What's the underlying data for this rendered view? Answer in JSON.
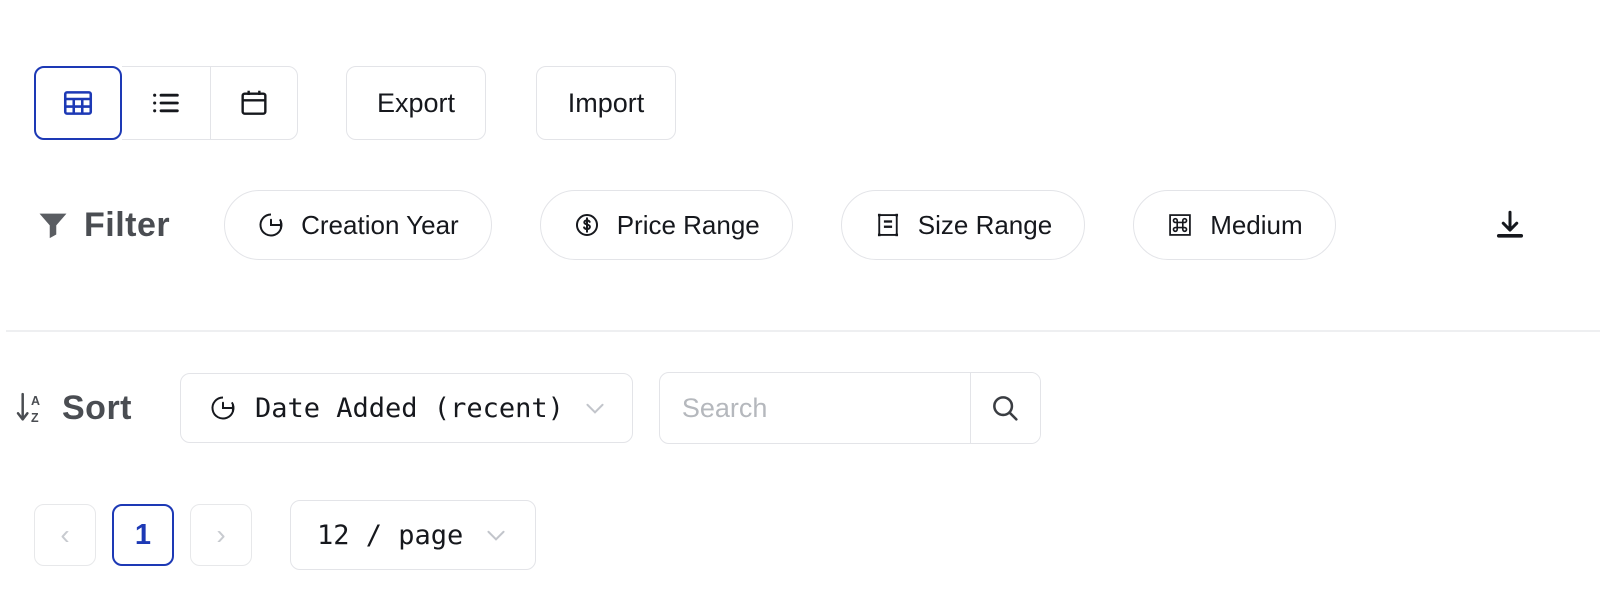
{
  "toolbar": {
    "views": [
      {
        "name": "grid",
        "icon": "grid-icon",
        "active": true
      },
      {
        "name": "list",
        "icon": "list-icon",
        "active": false
      },
      {
        "name": "calendar",
        "icon": "calendar-icon",
        "active": false
      }
    ],
    "export_label": "Export",
    "import_label": "Import"
  },
  "filter": {
    "label": "Filter",
    "icon": "funnel-icon",
    "chips": [
      {
        "label": "Creation Year",
        "icon": "clock-icon"
      },
      {
        "label": "Price Range",
        "icon": "dollar-circle-icon"
      },
      {
        "label": "Size Range",
        "icon": "ruler-box-icon"
      },
      {
        "label": "Medium",
        "icon": "command-box-icon"
      }
    ],
    "download_icon": "download-icon"
  },
  "sort": {
    "label": "Sort",
    "icon": "sort-az-icon",
    "selected": "Date Added (recent)",
    "selected_icon": "clock-icon",
    "chevron": "chevron-down-icon"
  },
  "search": {
    "value": "",
    "placeholder": "Search",
    "button_icon": "search-icon"
  },
  "pagination": {
    "prev_label": "‹",
    "next_label": "›",
    "pages": [
      "1"
    ],
    "current_page": "1",
    "page_size": "12 / page",
    "chevron": "chevron-down-icon"
  },
  "colors": {
    "accent": "#1d39b5",
    "text": "#16181d",
    "muted": "#b5b8bd",
    "border": "#e3e4e8",
    "divider": "#eeeff1"
  }
}
